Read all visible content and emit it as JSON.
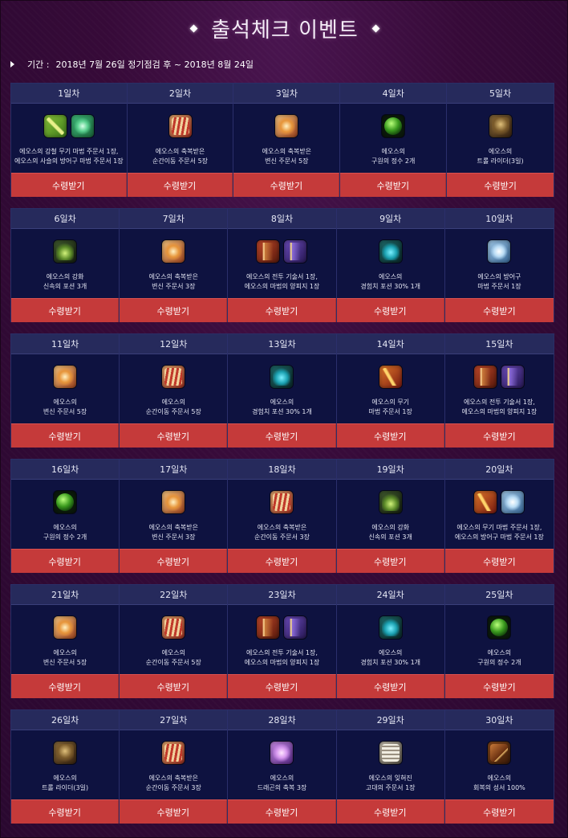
{
  "title": "출석체크 이벤트",
  "period": {
    "label": "기간 :",
    "value": "2018년 7월 26일 정기점검 후 ~ 2018년 8월 24일"
  },
  "claim_label": "수령받기",
  "colors": {
    "background": "#3a0b3a",
    "panel": "#0e1240",
    "header": "#262a5c",
    "claim_button": "#c53a3a"
  },
  "weeks": [
    {
      "days": [
        {
          "day": "1일차",
          "icons": [
            "weapon-scroll",
            "armor-scroll"
          ],
          "lines": [
            "에오스의 강철 무기 마법 주문서 1장,",
            "에오스의 사슬의 방어구 마법 주문서 1장"
          ]
        },
        {
          "day": "2일차",
          "icons": [
            "blessed-teleport"
          ],
          "lines": [
            "에오스의 축복받은",
            "순간이동 주문서 5장"
          ]
        },
        {
          "day": "3일차",
          "icons": [
            "blessed-poly"
          ],
          "lines": [
            "에오스의 축복받은",
            "변신 주문서 5장"
          ]
        },
        {
          "day": "4일차",
          "icons": [
            "green-orb"
          ],
          "lines": [
            "에오스의",
            "구원의 정수 2개"
          ]
        },
        {
          "day": "5일차",
          "icons": [
            "troll"
          ],
          "lines": [
            "에오스의",
            "트롤 라이더(3일)"
          ]
        }
      ]
    },
    {
      "days": [
        {
          "day": "6일차",
          "icons": [
            "haste-potion"
          ],
          "lines": [
            "에오스의 강화",
            "신속의 포션 3개"
          ]
        },
        {
          "day": "7일차",
          "icons": [
            "blessed-poly"
          ],
          "lines": [
            "에오스의 축복받은",
            "변신 주문서 3장"
          ]
        },
        {
          "day": "8일차",
          "icons": [
            "combat-scroll",
            "magic-parchment"
          ],
          "lines": [
            "에오스의 전투 기술서 1장,",
            "에오스의 마법의 양피지 1장"
          ]
        },
        {
          "day": "9일차",
          "icons": [
            "exp-potion"
          ],
          "lines": [
            "에오스의",
            "경험치 포션 30% 1개"
          ]
        },
        {
          "day": "10일차",
          "icons": [
            "armor-magic-scroll"
          ],
          "lines": [
            "에오스의 방어구",
            "마법 주문서 1장"
          ]
        }
      ]
    },
    {
      "days": [
        {
          "day": "11일차",
          "icons": [
            "blessed-poly"
          ],
          "lines": [
            "에오스의",
            "변신 주문서 5장"
          ]
        },
        {
          "day": "12일차",
          "icons": [
            "blessed-teleport"
          ],
          "lines": [
            "에오스의",
            "순간이동 주문서 5장"
          ]
        },
        {
          "day": "13일차",
          "icons": [
            "exp-potion"
          ],
          "lines": [
            "에오스의",
            "경험치 포션 30% 1개"
          ]
        },
        {
          "day": "14일차",
          "icons": [
            "weapon-magic-scroll"
          ],
          "lines": [
            "에오스의 무기",
            "마법 주문서 1장"
          ]
        },
        {
          "day": "15일차",
          "icons": [
            "combat-scroll",
            "magic-parchment"
          ],
          "lines": [
            "에오스의 전투 기술서 1장,",
            "에오스의 마법의 양피지 1장"
          ]
        }
      ]
    },
    {
      "days": [
        {
          "day": "16일차",
          "icons": [
            "green-orb"
          ],
          "lines": [
            "에오스의",
            "구원의 정수 2개"
          ]
        },
        {
          "day": "17일차",
          "icons": [
            "blessed-poly"
          ],
          "lines": [
            "에오스의 축복받은",
            "변신 주문서 3장"
          ]
        },
        {
          "day": "18일차",
          "icons": [
            "blessed-teleport"
          ],
          "lines": [
            "에오스의 축복받은",
            "순간이동 주문서 3장"
          ]
        },
        {
          "day": "19일차",
          "icons": [
            "haste-potion"
          ],
          "lines": [
            "에오스의 강화",
            "신속의 포션 3개"
          ]
        },
        {
          "day": "20일차",
          "icons": [
            "weapon-magic-scroll",
            "armor-magic-scroll"
          ],
          "lines": [
            "에오스의 무기 마법 주문서 1장,",
            "에오스의 방어구 마법 주문서 1장"
          ]
        }
      ]
    },
    {
      "days": [
        {
          "day": "21일차",
          "icons": [
            "blessed-poly"
          ],
          "lines": [
            "에오스의",
            "변신 주문서 5장"
          ]
        },
        {
          "day": "22일차",
          "icons": [
            "blessed-teleport"
          ],
          "lines": [
            "에오스의",
            "순간이동 주문서 5장"
          ]
        },
        {
          "day": "23일차",
          "icons": [
            "combat-scroll",
            "magic-parchment"
          ],
          "lines": [
            "에오스의 전투 기술서 1장,",
            "에오스의 마법의 양피지 1장"
          ]
        },
        {
          "day": "24일차",
          "icons": [
            "exp-potion"
          ],
          "lines": [
            "에오스의",
            "경험치 포션 30% 1개"
          ]
        },
        {
          "day": "25일차",
          "icons": [
            "green-orb"
          ],
          "lines": [
            "에오스의",
            "구원의 정수 2개"
          ]
        }
      ]
    },
    {
      "days": [
        {
          "day": "26일차",
          "icons": [
            "troll"
          ],
          "lines": [
            "에오스의",
            "트롤 라이더(3일)"
          ]
        },
        {
          "day": "27일차",
          "icons": [
            "blessed-teleport"
          ],
          "lines": [
            "에오스의 축복받은",
            "순간이동 주문서 3장"
          ]
        },
        {
          "day": "28일차",
          "icons": [
            "dragon-blessing"
          ],
          "lines": [
            "에오스의",
            "드래곤의 축복 3장"
          ]
        },
        {
          "day": "29일차",
          "icons": [
            "ancient-scroll"
          ],
          "lines": [
            "에오스의 잊혀진",
            "고대의 주문서 1장"
          ]
        },
        {
          "day": "30일차",
          "icons": [
            "holy-book"
          ],
          "lines": [
            "에오스의",
            "회복의 성서 100%"
          ]
        }
      ]
    }
  ]
}
